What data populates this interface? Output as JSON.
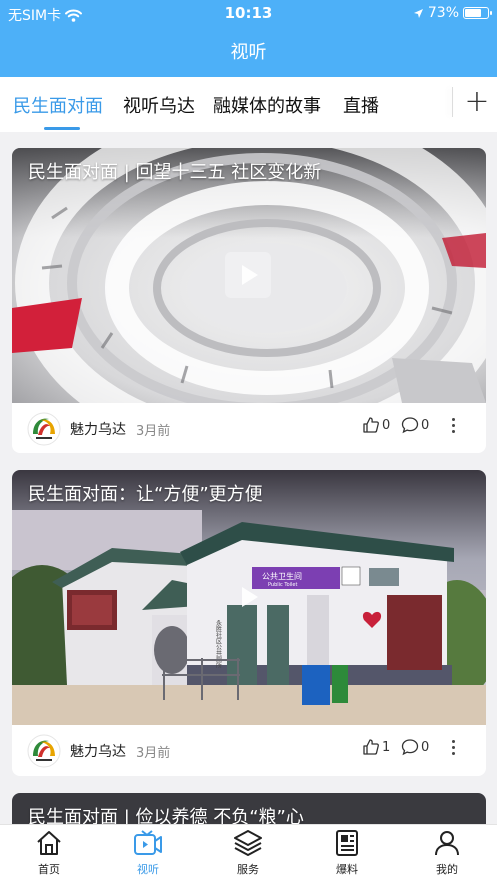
{
  "status_bar": {
    "carrier": "无SIM卡",
    "time": "10:13",
    "battery_percent": "73%",
    "battery_level": 0.73
  },
  "nav": {
    "title": "视听"
  },
  "tabs": [
    {
      "label": "民生面对面",
      "active": true
    },
    {
      "label": "视听乌达",
      "active": false
    },
    {
      "label": "融媒体的故事",
      "active": false
    },
    {
      "label": "直播",
      "active": false
    }
  ],
  "add_channel_label": "+",
  "posts": [
    {
      "title": "民生面对面 | 回望十三五 社区变化新",
      "author": "魅力乌达",
      "time": "3月前",
      "likes": "0",
      "comments": "0"
    },
    {
      "title": "民生面对面：让“方便”更方便",
      "author": "魅力乌达",
      "time": "3月前",
      "likes": "1",
      "comments": "0",
      "sign_text": "公共卫生间",
      "sign_sub": "Public Toilet",
      "building_text": "永胜社区公共厕所"
    },
    {
      "title": "民生面对面 | 俭以养德 不负“粮”心"
    }
  ],
  "bottom_nav": [
    {
      "label": "首页",
      "icon": "home-icon",
      "active": false
    },
    {
      "label": "视听",
      "icon": "video-icon",
      "active": true
    },
    {
      "label": "服务",
      "icon": "layers-icon",
      "active": false
    },
    {
      "label": "爆料",
      "icon": "news-icon",
      "active": false
    },
    {
      "label": "我的",
      "icon": "user-icon",
      "active": false
    }
  ],
  "colors": {
    "header": "#4db0f8",
    "accent": "#3a9ae8"
  }
}
